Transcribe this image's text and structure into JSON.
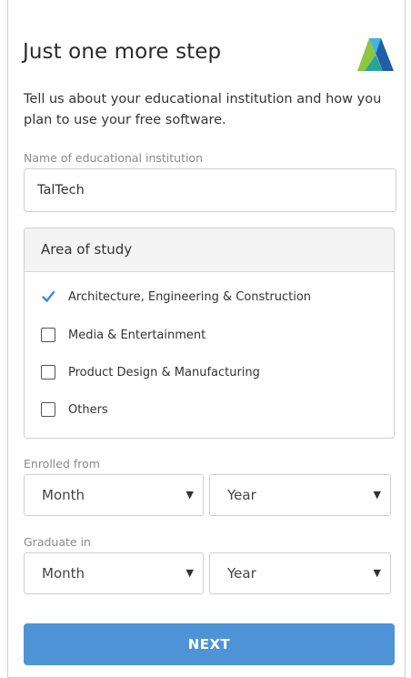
{
  "header": {
    "title": "Just one more step",
    "logo_icon": "autodesk-logo"
  },
  "intro_text": "Tell us about your educational institution and how you plan to use your free software.",
  "institution": {
    "label": "Name of educational institution",
    "value": "TalTech"
  },
  "area_of_study": {
    "heading": "Area of study",
    "options": [
      {
        "label": "Architecture, Engineering & Construction",
        "checked": true
      },
      {
        "label": "Media & Entertainment",
        "checked": false
      },
      {
        "label": "Product Design & Manufacturing",
        "checked": false
      },
      {
        "label": "Others",
        "checked": false
      }
    ]
  },
  "enrolled_from": {
    "label": "Enrolled from",
    "month": "Month",
    "year": "Year"
  },
  "graduate_in": {
    "label": "Graduate in",
    "month": "Month",
    "year": "Year"
  },
  "next_button": "NEXT",
  "colors": {
    "accent": "#4d93d6",
    "checkbox_checked": "#3b8ad9",
    "border": "#cfcfcf"
  }
}
